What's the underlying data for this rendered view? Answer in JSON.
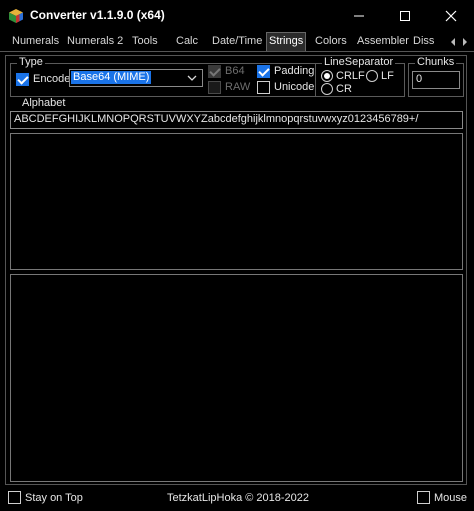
{
  "window": {
    "title": "Converter v1.1.9.0 (x64)",
    "minimize_glyph": "—",
    "maximize_glyph": "☐",
    "close_glyph": "✕"
  },
  "tabs": [
    "Numerals",
    "Numerals 2",
    "Tools",
    "Calc",
    "Date/Time",
    "Strings",
    "Colors",
    "Assembler",
    "Diss"
  ],
  "active_tab": "Strings",
  "type_group": {
    "label": "Type",
    "encode_label": "Encode",
    "encode_checked": true,
    "encoding_value": "Base64 (MIME)",
    "b64_label": "B64",
    "b64_checked": true,
    "raw_label": "RAW",
    "raw_checked": false,
    "padding_label": "Padding",
    "padding_checked": true,
    "unicode_label": "Unicode",
    "unicode_checked": false
  },
  "line_separator": {
    "label": "LineSeparator",
    "crlf_label": "CRLF",
    "lf_label": "LF",
    "cr_label": "CR",
    "selected": "CRLF"
  },
  "chunks": {
    "label": "Chunks",
    "value": "0"
  },
  "alphabet": {
    "label": "Alphabet",
    "value": "ABCDEFGHIJKLMNOPQRSTUVWXYZabcdefghijklmnopqrstuvwxyz0123456789+/"
  },
  "input_text": "",
  "output_text": "",
  "status": {
    "stay_on_top_label": "Stay on Top",
    "stay_on_top_checked": false,
    "copyright": "TetzkatLipHoka © 2018-2022",
    "mouse_label": "Mouse",
    "mouse_checked": false
  },
  "colors": {
    "accent": "#1a73e8",
    "background": "#000000",
    "text": "#e6e6e6"
  }
}
